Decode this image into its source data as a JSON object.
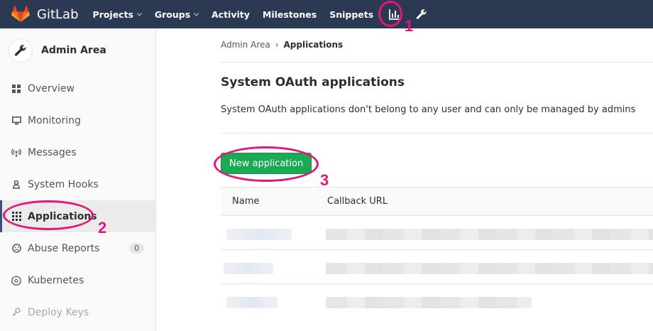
{
  "navbar": {
    "brand": "GitLab",
    "items": [
      {
        "label": "Projects",
        "dropdown": true
      },
      {
        "label": "Groups",
        "dropdown": true
      },
      {
        "label": "Activity"
      },
      {
        "label": "Milestones"
      },
      {
        "label": "Snippets"
      }
    ],
    "icons": [
      "chart-icon",
      "wrench-icon"
    ]
  },
  "sidebar": {
    "title": "Admin Area",
    "items": [
      {
        "label": "Overview",
        "icon": "grid-icon"
      },
      {
        "label": "Monitoring",
        "icon": "monitor-icon"
      },
      {
        "label": "Messages",
        "icon": "broadcast-icon"
      },
      {
        "label": "System Hooks",
        "icon": "hook-icon"
      },
      {
        "label": "Applications",
        "icon": "apps-icon",
        "active": true
      },
      {
        "label": "Abuse Reports",
        "icon": "abuse-icon",
        "badge": "0"
      },
      {
        "label": "Kubernetes",
        "icon": "kubernetes-icon"
      },
      {
        "label": "Deploy Keys",
        "icon": "key-icon"
      }
    ]
  },
  "breadcrumb": {
    "parent": "Admin Area",
    "sep": "›",
    "current": "Applications"
  },
  "page": {
    "title": "System OAuth applications",
    "description": "System OAuth applications don't belong to any user and can only be managed by admins",
    "new_button": "New application"
  },
  "table": {
    "headers": [
      "Name",
      "Callback URL"
    ],
    "rows": 3
  },
  "annotations": {
    "numbers": [
      "1",
      "2",
      "3"
    ],
    "color": "#e3167c"
  },
  "colors": {
    "navbar": "#2b3a52",
    "button": "#1aaa55",
    "active_border": "#3c4f73"
  }
}
